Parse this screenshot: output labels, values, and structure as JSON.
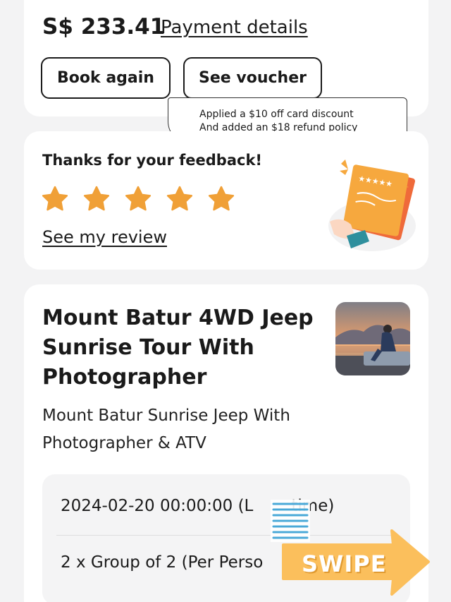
{
  "order": {
    "price": "S$ 233.41",
    "payment_link": "Payment details",
    "book_again_label": "Book again",
    "see_voucher_label": "See voucher"
  },
  "annotation": {
    "line1": "Applied a $10 off card discount",
    "line2": "And added an $18 refund policy"
  },
  "feedback": {
    "title": "Thanks for your feedback!",
    "rating": 5,
    "rating_max": 5,
    "review_link": "See my review"
  },
  "activity": {
    "title": "Mount Batur 4WD Jeep Sunrise Tour With Photographer",
    "package": "Mount Batur Sunrise Jeep With Photographer & ATV",
    "date": "2024-02-20 00:00:00 (L",
    "date_suffix": "time)",
    "group": "2 x Group of 2 (Per Perso"
  },
  "sticker": {
    "text": "SWIPE"
  },
  "colors": {
    "star": "#f0a037",
    "gift": "#f39a3a",
    "arrow": "#fbbf5c",
    "sticker_lines": "#4aa9d8"
  }
}
